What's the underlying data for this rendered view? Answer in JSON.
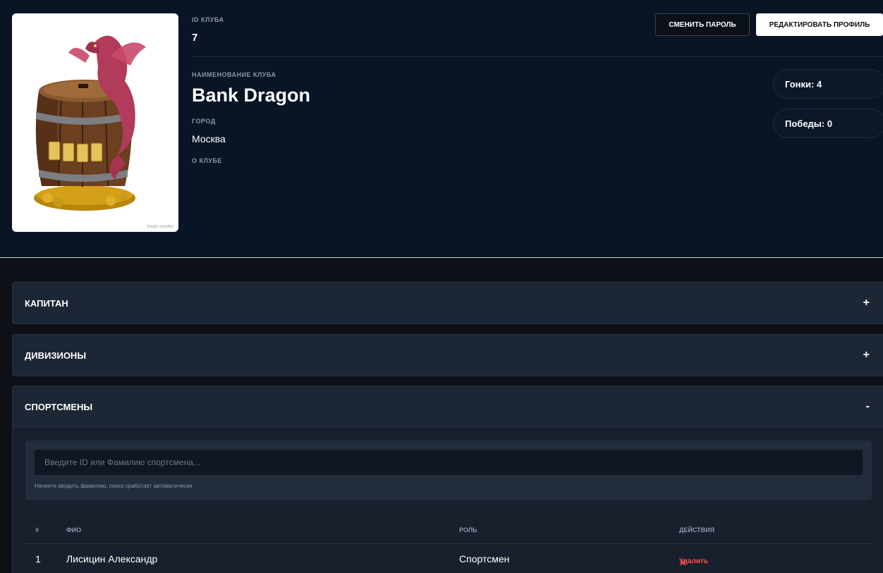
{
  "club": {
    "id_label": "ID клуба",
    "id_value": "7",
    "name_label": "Наименование клуба",
    "name_value": "Bank Dragon",
    "city_label": "Город",
    "city_value": "Москва",
    "about_label": "О клубе",
    "photo_credit": "magic-candles"
  },
  "actions": {
    "change_password": "Сменить пароль",
    "edit_profile": "Редактировать профиль"
  },
  "stats": {
    "races": "Гонки: 4",
    "wins": "Победы: 0"
  },
  "sections": {
    "captain": {
      "title": "Капитан",
      "toggle": "+"
    },
    "divisions": {
      "title": "Дивизионы",
      "toggle": "+"
    },
    "athletes": {
      "title": "Спортсмены",
      "toggle": "-"
    }
  },
  "search": {
    "placeholder": "Введите ID или Фамилию спортсмена...",
    "hint": "Начните вводить фамилию, поиск сработает автоматически"
  },
  "table": {
    "headers": {
      "num": "#",
      "name": "ФИО",
      "role": "Роль",
      "actions": "Действия"
    },
    "rows": [
      {
        "num": "1",
        "name": "Лисицин Александр",
        "role": "Спортсмен",
        "action_icon": "✕",
        "action": "Удалить"
      }
    ]
  },
  "colors": {
    "background": "#0d1117",
    "header_bg": "#091424",
    "panel": "#1d2634",
    "danger": "#ff4d4f"
  },
  "icons": {
    "delete": "close-icon",
    "expand": "plus-icon",
    "collapse": "minus-icon"
  }
}
